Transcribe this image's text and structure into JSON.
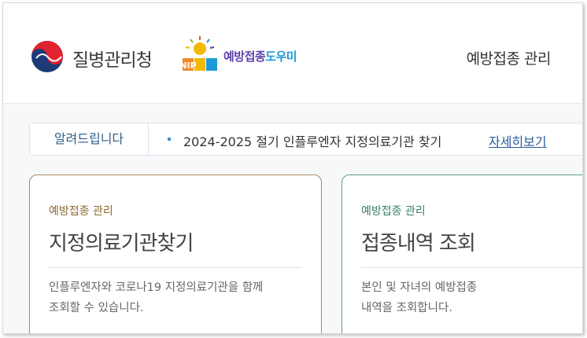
{
  "header": {
    "org_name": "질병관리청",
    "nip_name_part1": "예방접종",
    "nip_name_part2": "도우미",
    "nip_logo_text": "NIP",
    "menu_link": "예방접종 관리"
  },
  "notice": {
    "label": "알려드립니다",
    "text": "2024-2025 절기 인플루엔자 지정의료기관 찾기",
    "more_link": "자세히보기"
  },
  "cards": [
    {
      "category": "예방접종 관리",
      "title": "지정의료기관찾기",
      "desc_line1": "인플루엔자와 코로나19 지정의료기관을 함께",
      "desc_line2": "조회할 수 있습니다."
    },
    {
      "category": "예방접종 관리",
      "title": "접종내역 조회",
      "desc_line1": "본인 및 자녀의 예방접종",
      "desc_line2": "내역을 조회합니다."
    }
  ],
  "colors": {
    "card1_border": "#a8895e",
    "card2_border": "#5f9a89",
    "link_blue": "#2a5c9a"
  }
}
